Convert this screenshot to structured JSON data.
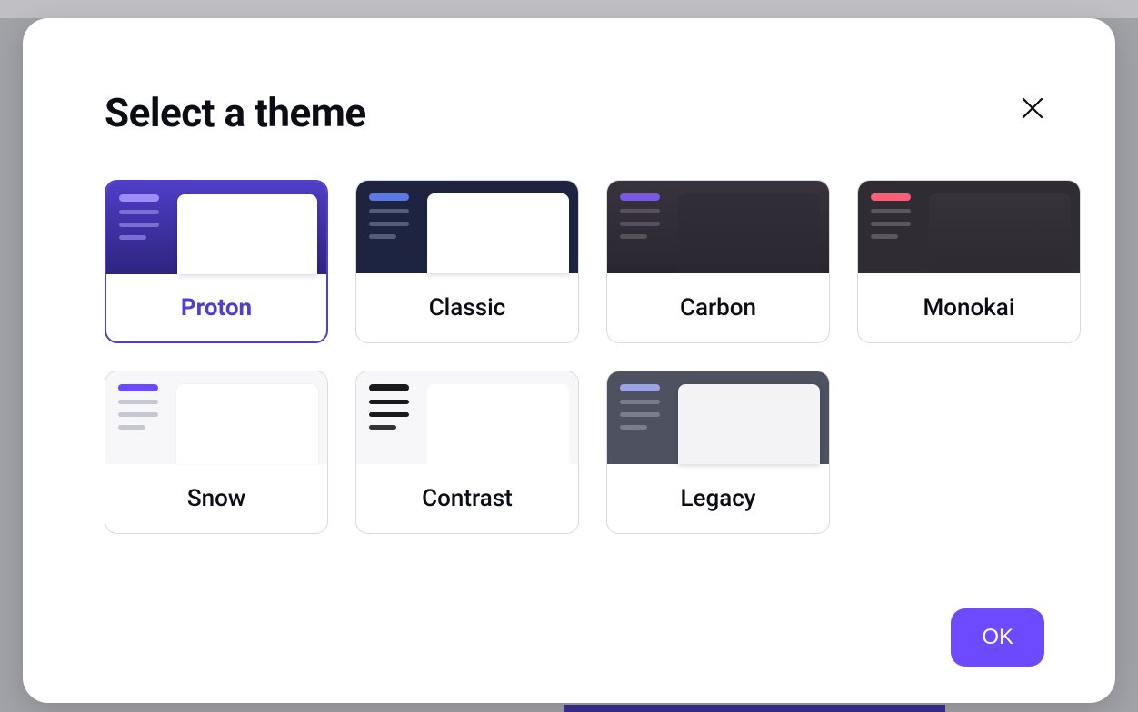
{
  "modal": {
    "title": "Select a theme",
    "ok_label": "OK"
  },
  "themes": [
    {
      "id": "proton",
      "label": "Proton",
      "selected": true
    },
    {
      "id": "classic",
      "label": "Classic",
      "selected": false
    },
    {
      "id": "carbon",
      "label": "Carbon",
      "selected": false
    },
    {
      "id": "monokai",
      "label": "Monokai",
      "selected": false
    },
    {
      "id": "snow",
      "label": "Snow",
      "selected": false
    },
    {
      "id": "contrast",
      "label": "Contrast",
      "selected": false
    },
    {
      "id": "legacy",
      "label": "Legacy",
      "selected": false
    }
  ]
}
